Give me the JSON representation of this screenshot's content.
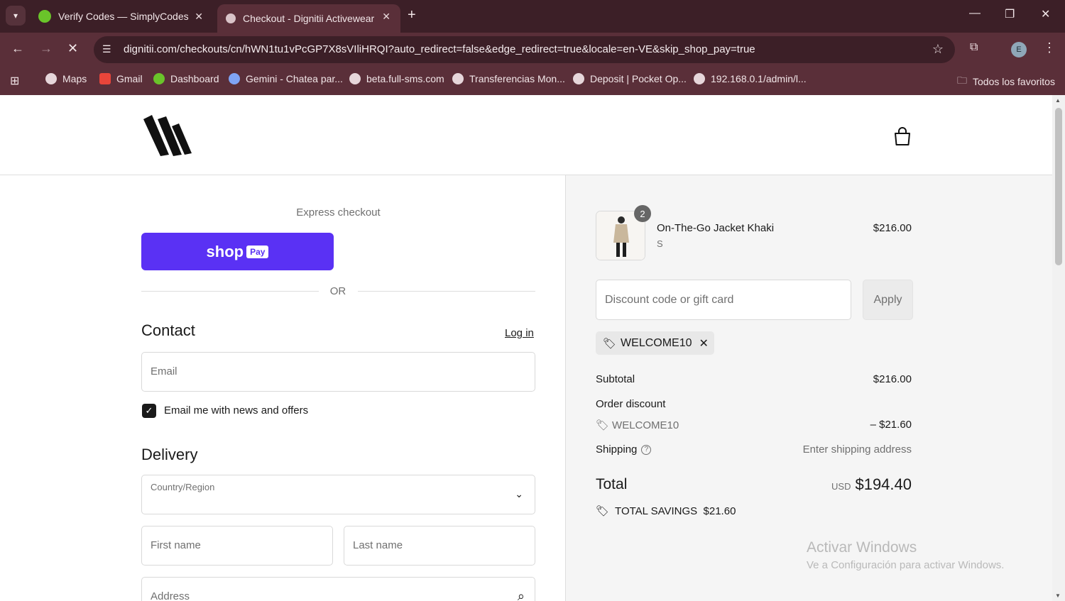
{
  "browser": {
    "tabs": [
      {
        "title": "Verify Codes — SimplyCodes"
      },
      {
        "title": "Checkout - Dignitii Activewear"
      }
    ],
    "url": "dignitii.com/checkouts/cn/hWN1tu1vPcGP7X8sVIliHRQI?auto_redirect=false&edge_redirect=true&locale=en-VE&skip_shop_pay=true",
    "profile_initial": "E",
    "bookmarks": [
      {
        "label": "Maps"
      },
      {
        "label": "Gmail"
      },
      {
        "label": "Dashboard"
      },
      {
        "label": "Gemini - Chatea par..."
      },
      {
        "label": "beta.full-sms.com"
      },
      {
        "label": "Transferencias Mon..."
      },
      {
        "label": "Deposit | Pocket Op..."
      },
      {
        "label": "192.168.0.1/admin/l..."
      }
    ],
    "all_bookmarks_label": "Todos los favoritos"
  },
  "checkout": {
    "express_label": "Express checkout",
    "shoppay_label": "shop",
    "shoppay_badge": "Pay",
    "or_label": "OR",
    "contact_heading": "Contact",
    "login_label": "Log in",
    "email_placeholder": "Email",
    "newsletter_label": "Email me with news and offers",
    "newsletter_checked": true,
    "delivery_heading": "Delivery",
    "country_label": "Country/Region",
    "first_name_placeholder": "First name",
    "last_name_placeholder": "Last name",
    "address_placeholder": "Address"
  },
  "summary": {
    "item": {
      "name": "On-The-Go Jacket Khaki",
      "variant": "S",
      "price": "$216.00",
      "quantity": "2"
    },
    "discount_placeholder": "Discount code or gift card",
    "apply_label": "Apply",
    "applied_code": "WELCOME10",
    "subtotal_label": "Subtotal",
    "subtotal_value": "$216.00",
    "order_discount_label": "Order discount",
    "discount_code": "WELCOME10",
    "discount_value": "– $21.60",
    "shipping_label": "Shipping",
    "shipping_value": "Enter shipping address",
    "total_label": "Total",
    "currency": "USD",
    "total_value": "$194.40",
    "savings_label": "TOTAL SAVINGS",
    "savings_value": "$21.60"
  },
  "watermark": {
    "line1": "Activar Windows",
    "line2": "Ve a Configuración para activar Windows."
  },
  "colors": {
    "shoppay": "#5a31f4",
    "chrome": "#3c1f27",
    "toolbar": "#5a2f39"
  }
}
